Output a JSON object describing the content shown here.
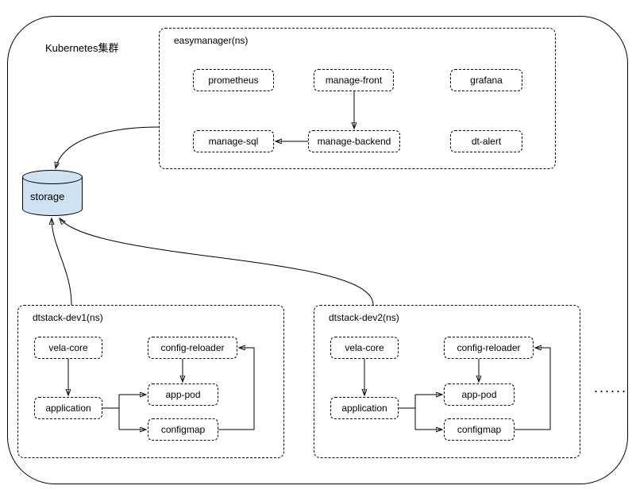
{
  "cluster_title": "Kubernetes集群",
  "storage_label": "storage",
  "ellipsis": "......",
  "ns_easymanager": {
    "title": "easymanager(ns)",
    "prometheus": "prometheus",
    "manage_front": "manage-front",
    "grafana": "grafana",
    "manage_sql": "manage-sql",
    "manage_backend": "manage-backend",
    "dt_alert": "dt-alert"
  },
  "ns_dev1": {
    "title": "dtstack-dev1(ns)",
    "vela_core": "vela-core",
    "config_reloader": "config-reloader",
    "application": "application",
    "app_pod": "app-pod",
    "configmap": "configmap"
  },
  "ns_dev2": {
    "title": "dtstack-dev2(ns)",
    "vela_core": "vela-core",
    "config_reloader": "config-reloader",
    "application": "application",
    "app_pod": "app-pod",
    "configmap": "configmap"
  }
}
